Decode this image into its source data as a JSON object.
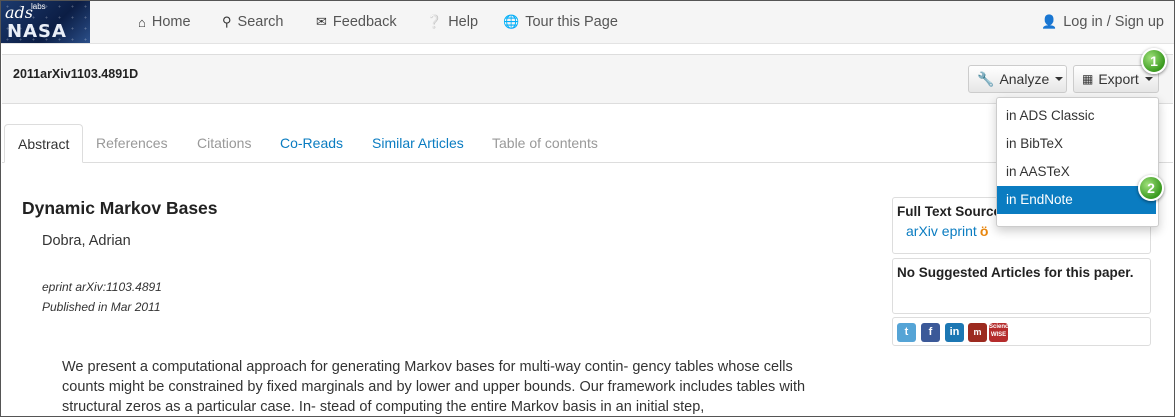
{
  "header": {
    "logo": {
      "ads": "ads",
      "labs": "labs",
      "nasa": "NASA"
    },
    "nav": {
      "home": {
        "label": "Home",
        "icon": "home-icon"
      },
      "search": {
        "label": "Search",
        "icon": "search-icon"
      },
      "feedback": {
        "label": "Feedback",
        "icon": "envelope-icon"
      },
      "help": {
        "label": "Help",
        "icon": "question-circle-icon"
      },
      "tour": {
        "label": "Tour this Page",
        "icon": "globe-icon"
      },
      "login": {
        "label": "Log in / Sign up",
        "icon": "user-icon"
      }
    }
  },
  "subbar": {
    "bibcode": "2011arXiv1103.4891D",
    "analyze_label": "Analyze",
    "export_label": "Export"
  },
  "export_menu": {
    "items": [
      {
        "label": "in ADS Classic"
      },
      {
        "label": "in BibTeX"
      },
      {
        "label": "in AASTeX"
      },
      {
        "label": "in EndNote",
        "highlighted": true
      }
    ]
  },
  "callouts": {
    "step1": "1",
    "step2": "2",
    "color": "#3a9a1f"
  },
  "tabs": [
    {
      "label": "Abstract",
      "active": true
    },
    {
      "label": "References"
    },
    {
      "label": "Citations"
    },
    {
      "label": "Co-Reads"
    },
    {
      "label": "Similar Articles"
    },
    {
      "label": "Table of contents"
    }
  ],
  "article": {
    "title": "Dynamic Markov Bases",
    "author": "Dobra, Adrian",
    "eprint": "eprint arXiv:1103.4891",
    "published": "Published in Mar 2011",
    "abstract": "We present a computational approach for generating Markov bases for multi-way contin- gency tables whose cells counts might be constrained by fixed marginals and by lower and upper bounds. Our framework includes tables with structural zeros as a particular case. In- stead of computing the entire Markov basis in an initial step,"
  },
  "sidebar": {
    "full_text_title": "Full Text Sources",
    "full_text_link": "arXiv eprint",
    "suggested": "No Suggested Articles for this paper.",
    "social": {
      "twitter": "t",
      "facebook": "f",
      "linkedin": "in",
      "mendeley": "m",
      "sciencewise": "Science WISE"
    }
  },
  "colors": {
    "link": "#0a7cc1",
    "highlight": "#0a7cc1",
    "open_access": "#e8860e"
  }
}
